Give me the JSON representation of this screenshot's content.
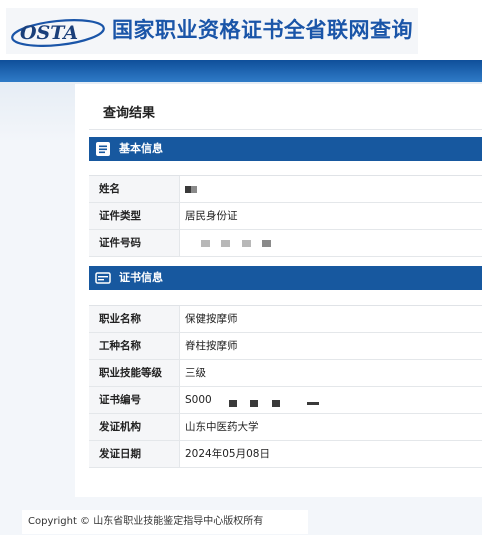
{
  "header": {
    "logo_text": "OSTA",
    "title": "国家职业资格证书全省联网查询"
  },
  "page": {
    "result_title": "查询结果"
  },
  "basic_info": {
    "section_label": "基本信息",
    "rows": [
      {
        "label": "姓名",
        "value": ""
      },
      {
        "label": "证件类型",
        "value": "居民身份证"
      },
      {
        "label": "证件号码",
        "value": ""
      }
    ]
  },
  "cert_info": {
    "section_label": "证书信息",
    "rows": [
      {
        "label": "职业名称",
        "value": "保健按摩师"
      },
      {
        "label": "工种名称",
        "value": "脊柱按摩师"
      },
      {
        "label": "职业技能等级",
        "value": "三级"
      },
      {
        "label": "证书编号",
        "value": "S000"
      },
      {
        "label": "发证机构",
        "value": "山东中医药大学"
      },
      {
        "label": "发证日期",
        "value": "2024年05月08日"
      }
    ]
  },
  "footer": {
    "copyright": "Copyright © 山东省职业技能鉴定指导中心版权所有"
  },
  "colors": {
    "brand_blue": "#17589f",
    "title_blue": "#1a55a8"
  }
}
